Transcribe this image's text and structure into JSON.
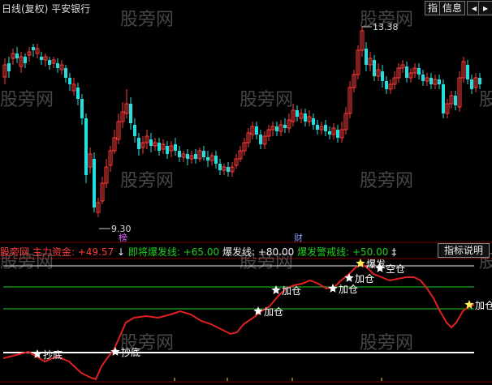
{
  "header": {
    "title": "日线(复权)  平安银行",
    "btn_indicator": "指",
    "btn_info": "信息",
    "arrow_left": "◂",
    "arrow_right": "▸"
  },
  "watermark": "股旁网",
  "price_panel": {
    "high_label": "13.38",
    "low_label": "9.30",
    "markers": [
      "榜",
      "财"
    ],
    "colors": {
      "up": "#ff3b3b",
      "down": "#22e0e0",
      "axis": "#7a0000"
    }
  },
  "indicator": {
    "name": "股旁网",
    "main_label": "主力资金:",
    "main_value": "+49.57",
    "arrow": "↓",
    "burst_label": "即将爆发线:",
    "burst_value": "+65.00",
    "blast_label": "爆发线:",
    "blast_value": "+80.00",
    "warn_label": "爆发警戒线:",
    "warn_value": "+50.00",
    "tail": "‡",
    "help_button": "指标说明",
    "signals": [
      {
        "label": "抄底"
      },
      {
        "label": "抄底"
      },
      {
        "label": "加仓"
      },
      {
        "label": "加仓"
      },
      {
        "label": "加仓"
      },
      {
        "label": "加仓"
      },
      {
        "label": "爆发"
      },
      {
        "label": "空仓"
      },
      {
        "label": "加仓"
      }
    ]
  }
}
